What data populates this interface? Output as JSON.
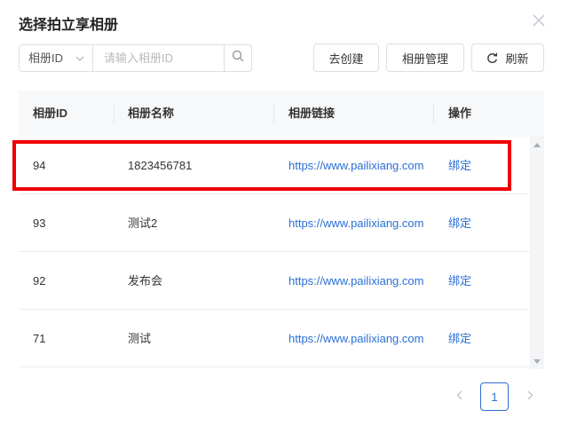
{
  "dialog": {
    "title": "选择拍立享相册"
  },
  "filter": {
    "field_select": "相册ID",
    "search_placeholder": "请输入相册ID",
    "search_value": ""
  },
  "toolbar": {
    "create_label": "去创建",
    "manage_label": "相册管理",
    "refresh_label": "刷新"
  },
  "table": {
    "columns": [
      "相册ID",
      "相册名称",
      "相册链接",
      "操作"
    ],
    "rows": [
      {
        "id": "94",
        "name": "1823456781",
        "link": "https://www.pailixiang.com",
        "action": "绑定"
      },
      {
        "id": "93",
        "name": "测试2",
        "link": "https://www.pailixiang.com",
        "action": "绑定"
      },
      {
        "id": "92",
        "name": "发布会",
        "link": "https://www.pailixiang.com",
        "action": "绑定"
      },
      {
        "id": "71",
        "name": "测试",
        "link": "https://www.pailixiang.com",
        "action": "绑定"
      }
    ]
  },
  "pagination": {
    "current_page": "1"
  },
  "colors": {
    "accent": "#2a6fd6",
    "highlight": "#ee0000",
    "header_bg": "#f7f8fa"
  }
}
